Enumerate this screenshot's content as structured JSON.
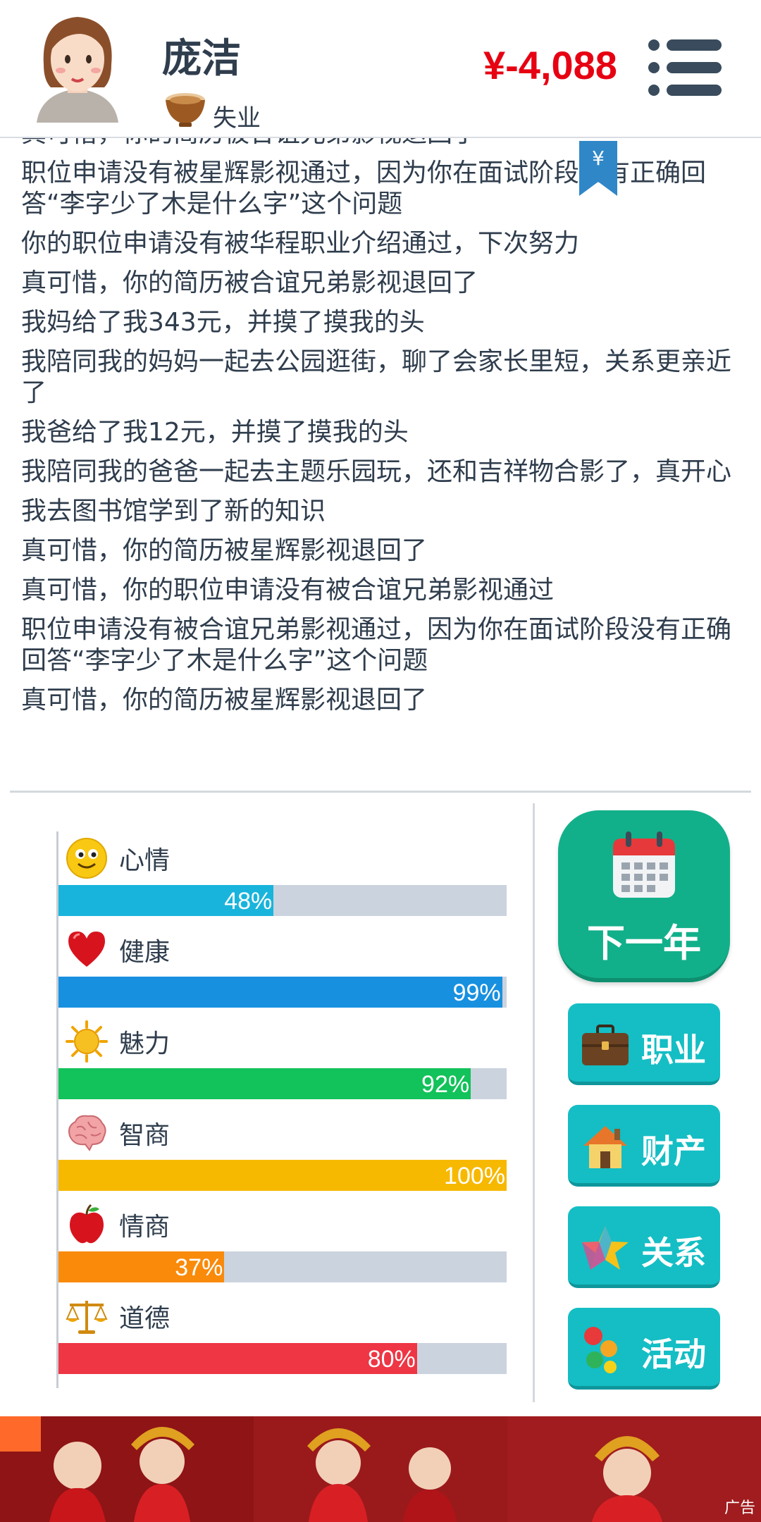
{
  "header": {
    "player_name": "庞洁",
    "job_status": "失业",
    "money": "¥-4,088",
    "menu_icon": "menu-icon"
  },
  "log": {
    "cut_line": "真可惜，你的简历被合谊兄弟影视退回了",
    "entries": [
      "职位申请没有被星辉影视通过，因为你在面试阶段没有正确回答“李字少了木是什么字”这个问题",
      "你的职位申请没有被华程职业介绍通过，下次努力",
      "真可惜，你的简历被合谊兄弟影视退回了",
      "我妈给了我343元，并摸了摸我的头",
      "我陪同我的妈妈一起去公园逛街，聊了会家长里短，关系更亲近了",
      "我爸给了我12元，并摸了摸我的头",
      "我陪同我的爸爸一起去主题乐园玩，还和吉祥物合影了，真开心",
      "我去图书馆学到了新的知识",
      "真可惜，你的简历被星辉影视退回了",
      "真可惜，你的职位申请没有被合谊兄弟影视通过",
      "职位申请没有被合谊兄弟影视通过，因为你在面试阶段没有正确回答“李字少了木是什么字”这个问题",
      "真可惜，你的简历被星辉影视退回了"
    ],
    "bookmark_symbol": "¥"
  },
  "stats": [
    {
      "label": "心情",
      "value": 48,
      "text": "48%",
      "color": "#19b4dc",
      "icon": "smiley-icon"
    },
    {
      "label": "健康",
      "value": 99,
      "text": "99%",
      "color": "#1890e0",
      "icon": "heart-icon"
    },
    {
      "label": "魅力",
      "value": 92,
      "text": "92%",
      "color": "#12c25a",
      "icon": "sun-icon"
    },
    {
      "label": "智商",
      "value": 100,
      "text": "100%",
      "color": "#f7b800",
      "icon": "brain-icon"
    },
    {
      "label": "情商",
      "value": 37,
      "text": "37%",
      "color": "#f98a0a",
      "icon": "apple-icon"
    },
    {
      "label": "道德",
      "value": 80,
      "text": "80%",
      "color": "#ee3645",
      "icon": "scales-icon"
    }
  ],
  "actions": {
    "next_year": "下一年",
    "career": "职业",
    "property": "财产",
    "relations": "关系",
    "activities": "活动"
  },
  "ad": {
    "tag": "广告"
  },
  "colors": {
    "money": "#e60012",
    "next_year_bg": "#12b08a",
    "action_bg": "#14bec4",
    "text": "#2f3d4d"
  }
}
